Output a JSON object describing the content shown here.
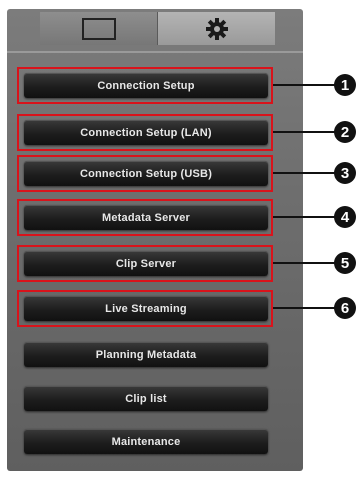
{
  "menu": {
    "items": [
      {
        "label": "Connection Setup",
        "callout": "1"
      },
      {
        "label": "Connection Setup (LAN)",
        "callout": "2"
      },
      {
        "label": "Connection Setup (USB)",
        "callout": "3"
      },
      {
        "label": "Metadata Server",
        "callout": "4"
      },
      {
        "label": "Clip Server",
        "callout": "5"
      },
      {
        "label": "Live Streaming",
        "callout": "6"
      },
      {
        "label": "Planning Metadata"
      },
      {
        "label": "Clip list"
      },
      {
        "label": "Maintenance"
      }
    ]
  },
  "tabs": {
    "monitor_icon": "monitor-icon",
    "settings_icon": "gear-icon"
  },
  "colors": {
    "highlight": "#d9131b",
    "callout": "#111111",
    "button_text": "#e8e8e8"
  }
}
